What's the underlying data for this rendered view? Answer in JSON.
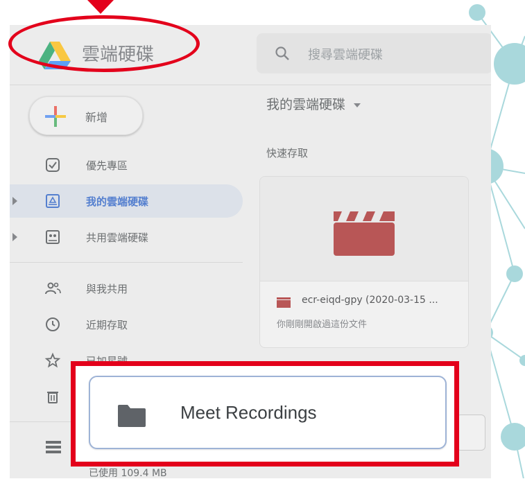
{
  "app": {
    "title": "雲端硬碟",
    "search_placeholder": "搜尋雲端硬碟"
  },
  "sidebar": {
    "new_button_label": "新增",
    "items": [
      {
        "label": "優先專區",
        "icon": "check-square-icon",
        "active": false,
        "expandable": false
      },
      {
        "label": "我的雲端硬碟",
        "icon": "drive-icon",
        "active": true,
        "expandable": true
      },
      {
        "label": "共用雲端硬碟",
        "icon": "shared-drive-icon",
        "active": false,
        "expandable": true
      },
      {
        "label": "與我共用",
        "icon": "people-icon",
        "active": false,
        "expandable": false
      },
      {
        "label": "近期存取",
        "icon": "clock-icon",
        "active": false,
        "expandable": false
      },
      {
        "label": "已加星號",
        "icon": "star-icon",
        "active": false,
        "expandable": false
      },
      {
        "label": "",
        "icon": "trash-icon",
        "active": false,
        "expandable": false
      }
    ],
    "storage_text": "已使用 109.4 MB"
  },
  "main": {
    "breadcrumb": "我的雲端硬碟",
    "quick_access_label": "快速存取",
    "quick_access_card": {
      "file_name": "ecr-eiqd-gpy (2020-03-15 ...",
      "subtitle": "你剛剛開啟過這份文件"
    }
  },
  "highlight": {
    "folder_name": "Meet Recordings"
  },
  "colors": {
    "highlight_red": "#e3001b",
    "active_blue": "#1a56c4",
    "video_red": "#a51d1d",
    "network_teal": "#a9d8dc"
  }
}
